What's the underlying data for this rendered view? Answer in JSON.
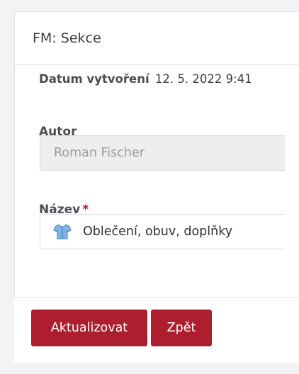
{
  "panel": {
    "title": "FM: Sekce"
  },
  "created": {
    "label": "Datum vytvoření",
    "value": "12. 5. 2022 9:41"
  },
  "author": {
    "label": "Autor",
    "value": "Roman Fischer"
  },
  "name": {
    "label": "Název",
    "required_mark": "*",
    "icon": "shirt-icon",
    "value": "Oblečení, obuv, doplňky"
  },
  "actions": {
    "update_label": "Aktualizovat",
    "back_label": "Zpět"
  },
  "colors": {
    "accent": "#ad1f2f",
    "disabled_input": "#eeeeee"
  }
}
